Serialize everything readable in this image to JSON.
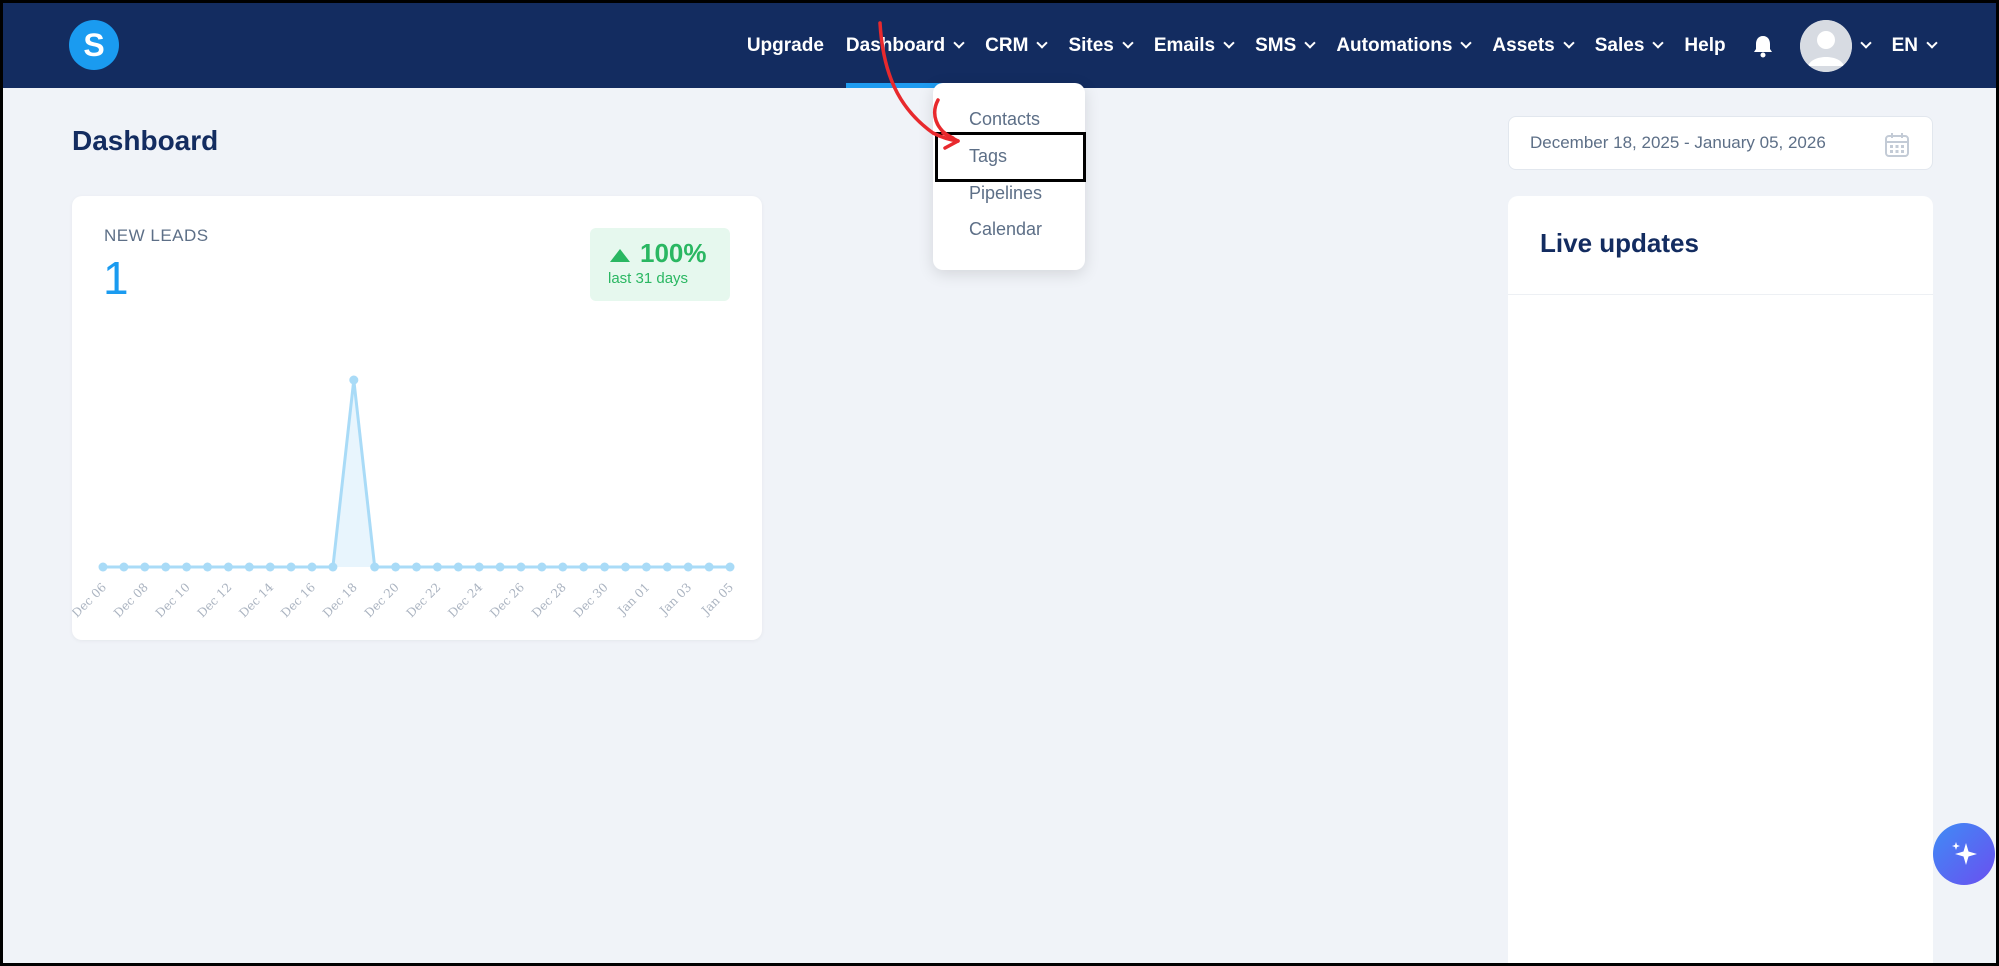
{
  "nav": {
    "logo_letter": "S",
    "items": [
      {
        "label": "Upgrade",
        "dropdown": false,
        "active": false
      },
      {
        "label": "Dashboard",
        "dropdown": true,
        "active": true
      },
      {
        "label": "CRM",
        "dropdown": true,
        "active": false
      },
      {
        "label": "Sites",
        "dropdown": true,
        "active": false
      },
      {
        "label": "Emails",
        "dropdown": true,
        "active": false
      },
      {
        "label": "SMS",
        "dropdown": true,
        "active": false
      },
      {
        "label": "Automations",
        "dropdown": true,
        "active": false
      },
      {
        "label": "Assets",
        "dropdown": true,
        "active": false
      },
      {
        "label": "Sales",
        "dropdown": true,
        "active": false
      },
      {
        "label": "Help",
        "dropdown": false,
        "active": false
      }
    ],
    "bell_icon": "bell-icon",
    "language": "EN"
  },
  "dropdown": {
    "items": [
      "Contacts",
      "Tags",
      "Pipelines",
      "Calendar"
    ],
    "highlighted": "Tags"
  },
  "page": {
    "title": "Dashboard",
    "date_range": "December 18, 2025 - January 05, 2026"
  },
  "leads_card": {
    "label": "NEW LEADS",
    "count": "1",
    "change_pct": "100%",
    "change_period": "last 31 days"
  },
  "chart_data": {
    "type": "area",
    "x": [
      "Dec 06",
      "Dec 07",
      "Dec 08",
      "Dec 09",
      "Dec 10",
      "Dec 11",
      "Dec 12",
      "Dec 13",
      "Dec 14",
      "Dec 15",
      "Dec 16",
      "Dec 17",
      "Dec 18",
      "Dec 19",
      "Dec 20",
      "Dec 21",
      "Dec 22",
      "Dec 23",
      "Dec 24",
      "Dec 25",
      "Dec 26",
      "Dec 27",
      "Dec 28",
      "Dec 29",
      "Dec 30",
      "Dec 31",
      "Jan 01",
      "Jan 02",
      "Jan 03",
      "Jan 04",
      "Jan 05"
    ],
    "tick_labels": [
      "Dec 06",
      "Dec 08",
      "Dec 10",
      "Dec 12",
      "Dec 14",
      "Dec 16",
      "Dec 18",
      "Dec 20",
      "Dec 22",
      "Dec 24",
      "Dec 26",
      "Dec 28",
      "Dec 30",
      "Jan 01",
      "Jan 03",
      "Jan 05"
    ],
    "values": [
      0,
      0,
      0,
      0,
      0,
      0,
      0,
      0,
      0,
      0,
      0,
      0,
      1,
      0,
      0,
      0,
      0,
      0,
      0,
      0,
      0,
      0,
      0,
      0,
      0,
      0,
      0,
      0,
      0,
      0,
      0
    ],
    "ylim": [
      0,
      1
    ],
    "color": "#a9dbf7",
    "fill": "#e8f5fd",
    "grid": false
  },
  "live_updates": {
    "title": "Live updates"
  },
  "colors": {
    "nav_bg": "#132c60",
    "accent": "#1a9bf0",
    "positive": "#2ab762",
    "page_bg": "#f0f3f8"
  }
}
